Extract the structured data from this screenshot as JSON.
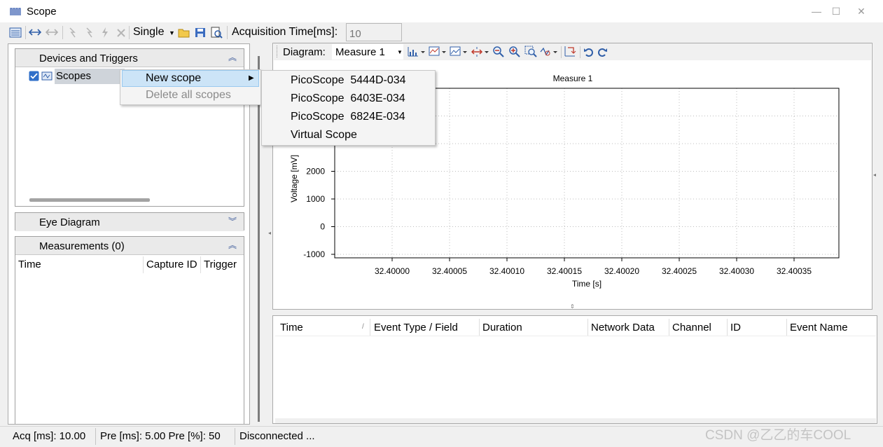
{
  "window": {
    "title": "Scope",
    "minimize": "—",
    "maximize": "☐",
    "close": "✕"
  },
  "toolbar": {
    "mode_label": "Single",
    "acquisition_label": "Acquisition Time[ms]:",
    "acquisition_value": "10"
  },
  "left": {
    "devices_panel": {
      "title": "Devices and Triggers",
      "tree_item": "Scopes",
      "checked": true
    },
    "eye_panel": {
      "title": "Eye Diagram"
    },
    "measurements_panel": {
      "title": "Measurements (0)",
      "columns": [
        "Time",
        "Capture ID",
        "Trigger"
      ]
    }
  },
  "context_menu": {
    "items": [
      {
        "label": "New scope",
        "enabled": true,
        "has_submenu": true
      },
      {
        "label": "Delete all scopes",
        "enabled": false
      }
    ],
    "submenu": [
      "PicoScope  5444D-034",
      "PicoScope  6403E-034",
      "PicoScope  6824E-034",
      "Virtual Scope"
    ]
  },
  "diagram": {
    "label": "Diagram:",
    "selected": "Measure 1"
  },
  "chart_data": {
    "type": "line",
    "title": "Measure 1",
    "xlabel": "Time [s]",
    "ylabel": "Voltage [mV]",
    "x_ticks": [
      "32.40000",
      "32.40005",
      "32.40010",
      "32.40015",
      "32.40020",
      "32.40025",
      "32.40030",
      "32.40035"
    ],
    "y_ticks": [
      "2000",
      "1000",
      "0",
      "-1000"
    ],
    "ylim": [
      -1000,
      5000
    ],
    "grid": true,
    "series": []
  },
  "events": {
    "columns": [
      "Time",
      "Event Type / Field",
      "Duration",
      "Network Data",
      "Channel",
      "ID",
      "Event Name"
    ],
    "sort_indicator": "/"
  },
  "status": {
    "acq": "Acq [ms]: 10.00",
    "pre": "Pre [ms]:  5.00 Pre [%]:  50",
    "connection": "Disconnected ..."
  },
  "watermark": "CSDN @乙乙的车COOL",
  "colors": {
    "menu_highlight": "#cce4f7",
    "check_blue": "#2f6fc9",
    "grid": "#bdbdbd"
  }
}
